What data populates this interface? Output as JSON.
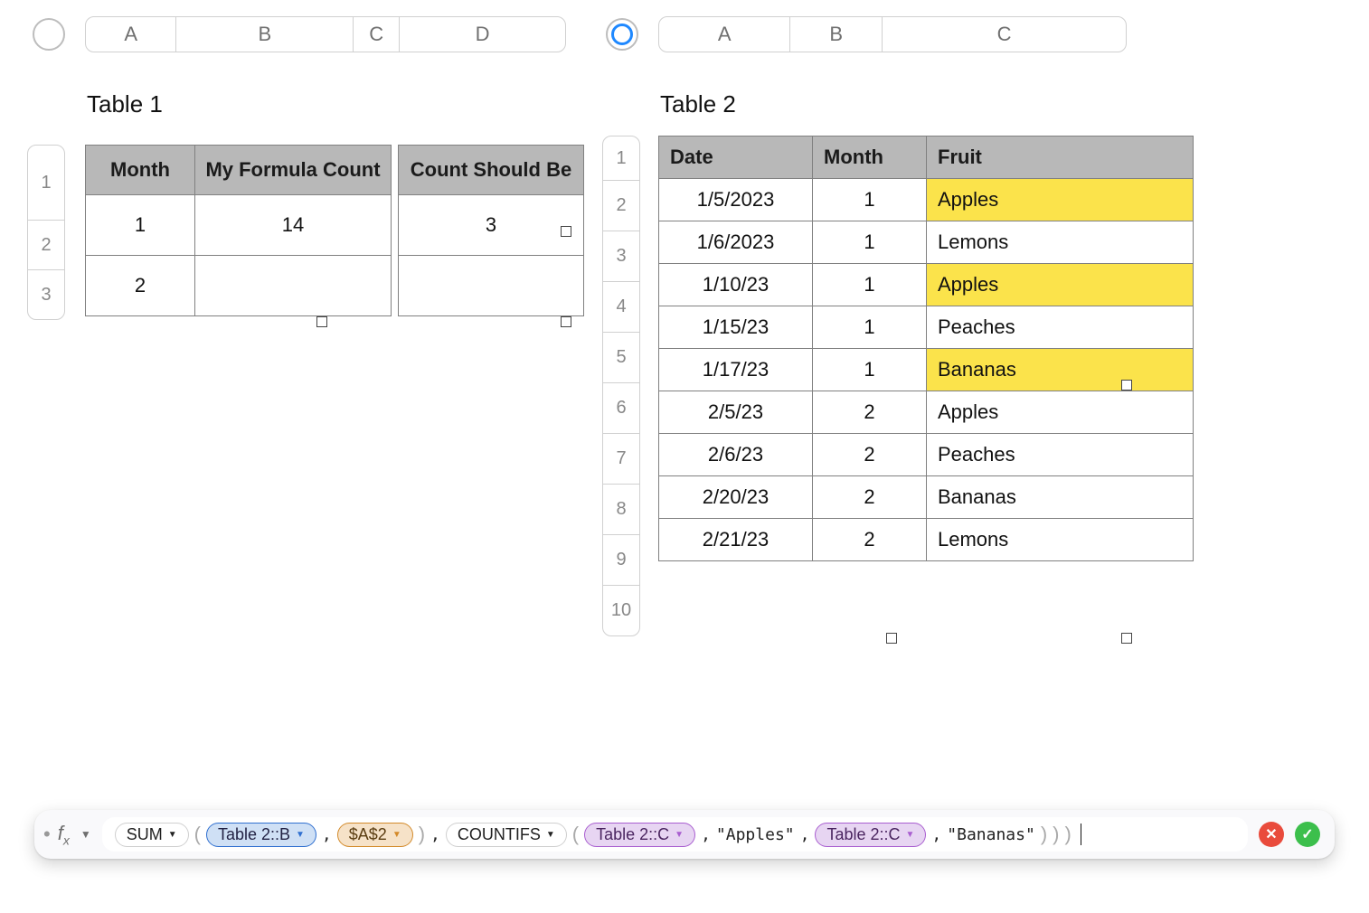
{
  "table1": {
    "title": "Table 1",
    "col_ruler": [
      "A",
      "B",
      "C",
      "D"
    ],
    "row_ruler": [
      "1",
      "2",
      "3"
    ],
    "headers": {
      "month": "Month",
      "formula_count": "My Formula Count",
      "count_should_be": "Count Should Be"
    },
    "rows": [
      {
        "month": "1",
        "formula_count": "14",
        "count_should_be": "3"
      },
      {
        "month": "2",
        "formula_count": "",
        "count_should_be": ""
      }
    ]
  },
  "table2": {
    "title": "Table 2",
    "col_ruler": [
      "A",
      "B",
      "C"
    ],
    "row_ruler": [
      "1",
      "2",
      "3",
      "4",
      "5",
      "6",
      "7",
      "8",
      "9",
      "10"
    ],
    "headers": {
      "date": "Date",
      "month": "Month",
      "fruit": "Fruit"
    },
    "rows": [
      {
        "date": "1/5/2023",
        "month": "1",
        "fruit": "Apples",
        "highlight": true
      },
      {
        "date": "1/6/2023",
        "month": "1",
        "fruit": "Lemons",
        "highlight": false
      },
      {
        "date": "1/10/23",
        "month": "1",
        "fruit": "Apples",
        "highlight": true
      },
      {
        "date": "1/15/23",
        "month": "1",
        "fruit": "Peaches",
        "highlight": false
      },
      {
        "date": "1/17/23",
        "month": "1",
        "fruit": "Bananas",
        "highlight": true
      },
      {
        "date": "2/5/23",
        "month": "2",
        "fruit": "Apples",
        "highlight": false
      },
      {
        "date": "2/6/23",
        "month": "2",
        "fruit": "Peaches",
        "highlight": false
      },
      {
        "date": "2/20/23",
        "month": "2",
        "fruit": "Bananas",
        "highlight": false
      },
      {
        "date": "2/21/23",
        "month": "2",
        "fruit": "Lemons",
        "highlight": false
      }
    ]
  },
  "formula_bar": {
    "tokens": {
      "sum": "SUM",
      "ref_b": "Table 2::B",
      "ref_a2": "$A$2",
      "countifs": "COUNTIFS",
      "ref_c1": "Table 2::C",
      "apples": "\"Apples\"",
      "ref_c2": "Table 2::C",
      "bananas": "\"Bananas\""
    },
    "comma": ","
  },
  "icons": {
    "cancel": "✕",
    "accept": "✓",
    "dropdown": "▼"
  }
}
